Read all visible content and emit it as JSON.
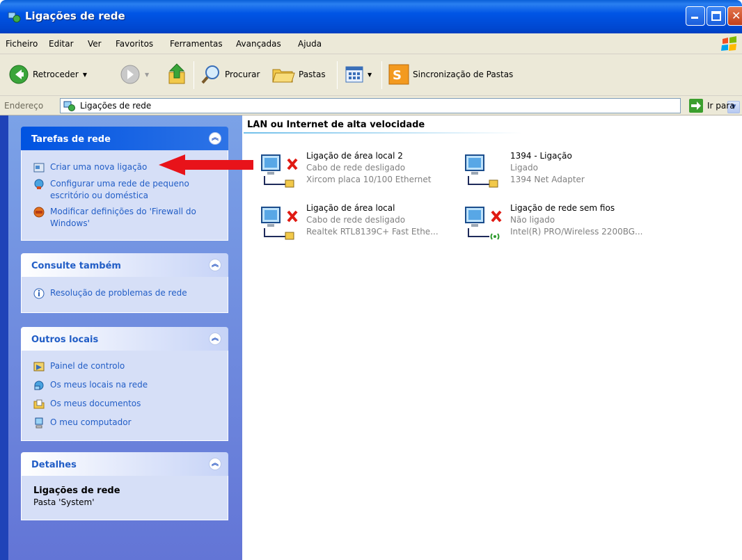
{
  "window": {
    "title": "Ligações de rede"
  },
  "menu": [
    "Ficheiro",
    "Editar",
    "Ver",
    "Favoritos",
    "Ferramentas",
    "Avançadas",
    "Ajuda"
  ],
  "toolbar": {
    "back_label": "Retroceder",
    "search_label": "Procurar",
    "folders_label": "Pastas",
    "sync_label": "Sincronização de Pastas"
  },
  "address": {
    "label": "Endereço",
    "value": "Ligações de rede",
    "go_label": "Ir para"
  },
  "left": {
    "network_tasks": {
      "title": "Tarefas de rede",
      "items": [
        "Criar uma nova ligação",
        "Configurar uma rede de pequeno escritório ou doméstica",
        "Modificar definições do 'Firewall do Windows'"
      ]
    },
    "see_also": {
      "title": "Consulte também",
      "items": [
        "Resolução de problemas de rede"
      ]
    },
    "other_places": {
      "title": "Outros locais",
      "items": [
        "Painel de controlo",
        "Os meus locais na rede",
        "Os meus documentos",
        "O meu computador"
      ]
    },
    "details": {
      "title": "Detalhes",
      "name": "Ligações de rede",
      "type": "Pasta 'System'"
    }
  },
  "main": {
    "group_title": "LAN ou Internet de alta velocidade",
    "connections": [
      {
        "name": "Ligação de área local 2",
        "status": "Cabo de rede desligado",
        "device": "Xircom placa 10/100 Ethernet"
      },
      {
        "name": "1394 - Ligação",
        "status": "Ligado",
        "device": "1394 Net Adapter"
      },
      {
        "name": "Ligação de área local",
        "status": "Cabo de rede desligado",
        "device": "Realtek RTL8139C+ Fast Ethe..."
      },
      {
        "name": "Ligação de rede sem fios",
        "status": "Não ligado",
        "device": "Intel(R) PRO/Wireless 2200BG..."
      }
    ]
  },
  "colors": {
    "title_blue": "#0054e3",
    "task_link": "#215dc6",
    "panel_bg": "#d6dff7",
    "arrow_red": "#e8131a"
  }
}
